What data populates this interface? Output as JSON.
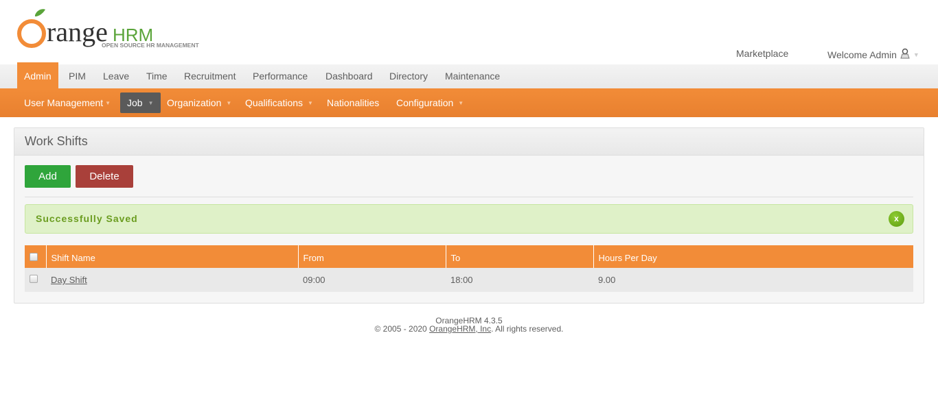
{
  "logo": {
    "text": "OrangeHRM",
    "tagline": "OPEN SOURCE HR MANAGEMENT"
  },
  "header": {
    "marketplace": "Marketplace",
    "welcome": "Welcome Admin"
  },
  "main_menu": [
    "Admin",
    "PIM",
    "Leave",
    "Time",
    "Recruitment",
    "Performance",
    "Dashboard",
    "Directory",
    "Maintenance"
  ],
  "sub_menu": [
    "User Management",
    "Job",
    "Organization",
    "Qualifications",
    "Nationalities",
    "Configuration"
  ],
  "panel": {
    "title": "Work Shifts",
    "add": "Add",
    "delete": "Delete",
    "message": "Successfully Saved",
    "close": "x"
  },
  "table": {
    "headers": [
      "Shift Name",
      "From",
      "To",
      "Hours Per Day"
    ],
    "rows": [
      [
        "Day Shift",
        "09:00",
        "18:00",
        "9.00"
      ]
    ]
  },
  "footer": {
    "version": "OrangeHRM 4.3.5",
    "copy_prefix": "© 2005 - 2020 ",
    "company": "OrangeHRM, Inc",
    "copy_suffix": ". All rights reserved."
  },
  "colors": {
    "accent": "#f28c38",
    "add": "#2fa53b",
    "delete": "#a9403a",
    "success_bg": "#dff1c8"
  }
}
